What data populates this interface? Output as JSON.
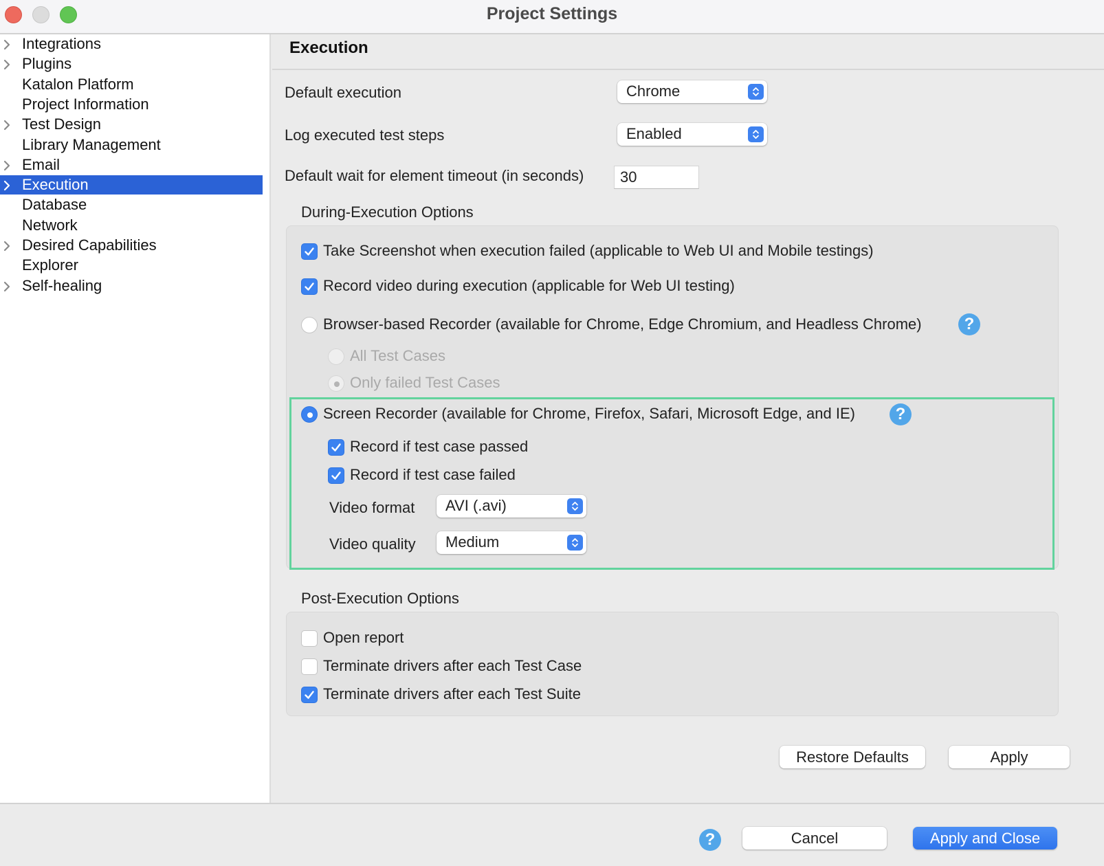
{
  "window": {
    "title": "Project Settings"
  },
  "sidebar": {
    "items": [
      {
        "label": "Integrations",
        "expandable": true,
        "selected": false
      },
      {
        "label": "Plugins",
        "expandable": true,
        "selected": false
      },
      {
        "label": "Katalon Platform",
        "expandable": false,
        "selected": false
      },
      {
        "label": "Project Information",
        "expandable": false,
        "selected": false
      },
      {
        "label": "Test Design",
        "expandable": true,
        "selected": false
      },
      {
        "label": "Library Management",
        "expandable": false,
        "selected": false
      },
      {
        "label": "Email",
        "expandable": true,
        "selected": false
      },
      {
        "label": "Execution",
        "expandable": true,
        "selected": true
      },
      {
        "label": "Database",
        "expandable": false,
        "selected": false
      },
      {
        "label": "Network",
        "expandable": false,
        "selected": false
      },
      {
        "label": "Desired Capabilities",
        "expandable": true,
        "selected": false
      },
      {
        "label": "Explorer",
        "expandable": false,
        "selected": false
      },
      {
        "label": "Self-healing",
        "expandable": true,
        "selected": false
      }
    ]
  },
  "main": {
    "page_title": "Execution",
    "default_execution": {
      "label": "Default execution",
      "value": "Chrome"
    },
    "log_steps": {
      "label": "Log executed test steps",
      "value": "Enabled"
    },
    "wait_timeout": {
      "label": "Default wait for element timeout (in seconds)",
      "value": "30"
    },
    "during": {
      "title": "During-Execution Options",
      "take_screenshot": {
        "label": "Take Screenshot when execution failed (applicable to Web UI and Mobile testings)",
        "checked": true
      },
      "record_video": {
        "label": "Record video during execution (applicable for Web UI testing)",
        "checked": true
      },
      "browser_recorder": {
        "label": "Browser-based Recorder (available for Chrome, Edge Chromium, and Headless Chrome)",
        "selected": false
      },
      "all_test_cases": {
        "label": "All Test Cases",
        "selected": false,
        "disabled": true
      },
      "only_failed": {
        "label": "Only failed Test Cases",
        "selected": true,
        "disabled": true
      },
      "screen_recorder": {
        "label": "Screen Recorder (available for Chrome, Firefox, Safari, Microsoft Edge, and IE)",
        "selected": true
      },
      "record_passed": {
        "label": "Record if test case passed",
        "checked": true
      },
      "record_failed": {
        "label": "Record if test case failed",
        "checked": true
      },
      "video_format": {
        "label": "Video format",
        "value": "AVI (.avi)"
      },
      "video_quality": {
        "label": "Video quality",
        "value": "Medium"
      }
    },
    "post": {
      "title": "Post-Execution Options",
      "open_report": {
        "label": "Open report",
        "checked": false
      },
      "terminate_case": {
        "label": "Terminate drivers after each Test Case",
        "checked": false
      },
      "terminate_suite": {
        "label": "Terminate drivers after each Test Suite",
        "checked": true
      }
    },
    "restore_defaults_label": "Restore Defaults",
    "apply_label": "Apply"
  },
  "footer": {
    "help_glyph": "?",
    "cancel_label": "Cancel",
    "apply_close_label": "Apply and Close"
  },
  "icons": {
    "help_glyph": "?"
  },
  "colors": {
    "accent": "#3b82f0",
    "selection": "#2b62d6",
    "highlight": "#62d39d",
    "help": "#52a6e9"
  }
}
